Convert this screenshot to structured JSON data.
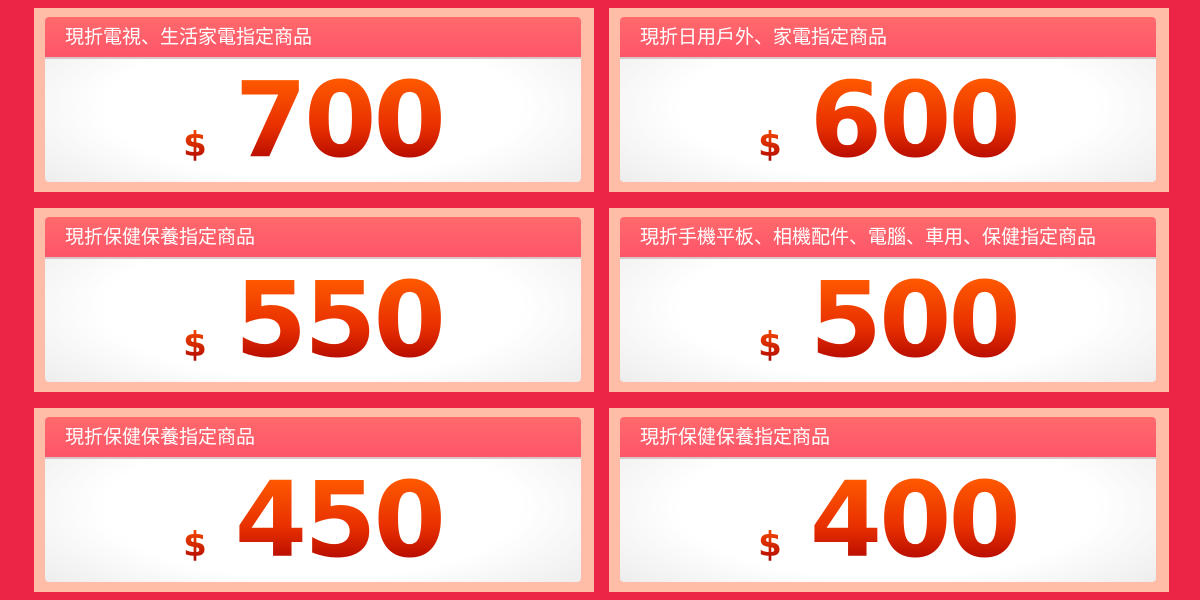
{
  "currency_symbol": "$",
  "coupons": [
    {
      "title": "現折電視、生活家電指定商品",
      "amount": "700"
    },
    {
      "title": "現折日用戶外、家電指定商品",
      "amount": "600"
    },
    {
      "title": "現折保健保養指定商品",
      "amount": "550"
    },
    {
      "title": "現折手機平板、相機配件、電腦、車用、保健指定商品",
      "amount": "500"
    },
    {
      "title": "現折保健保養指定商品",
      "amount": "450"
    },
    {
      "title": "現折保健保養指定商品",
      "amount": "400"
    }
  ],
  "colors": {
    "background": "#ec2546",
    "panel": "#ffbda8",
    "header": "#fe5c6b",
    "amount_top": "#ff5a00",
    "amount_bottom": "#a80000"
  }
}
